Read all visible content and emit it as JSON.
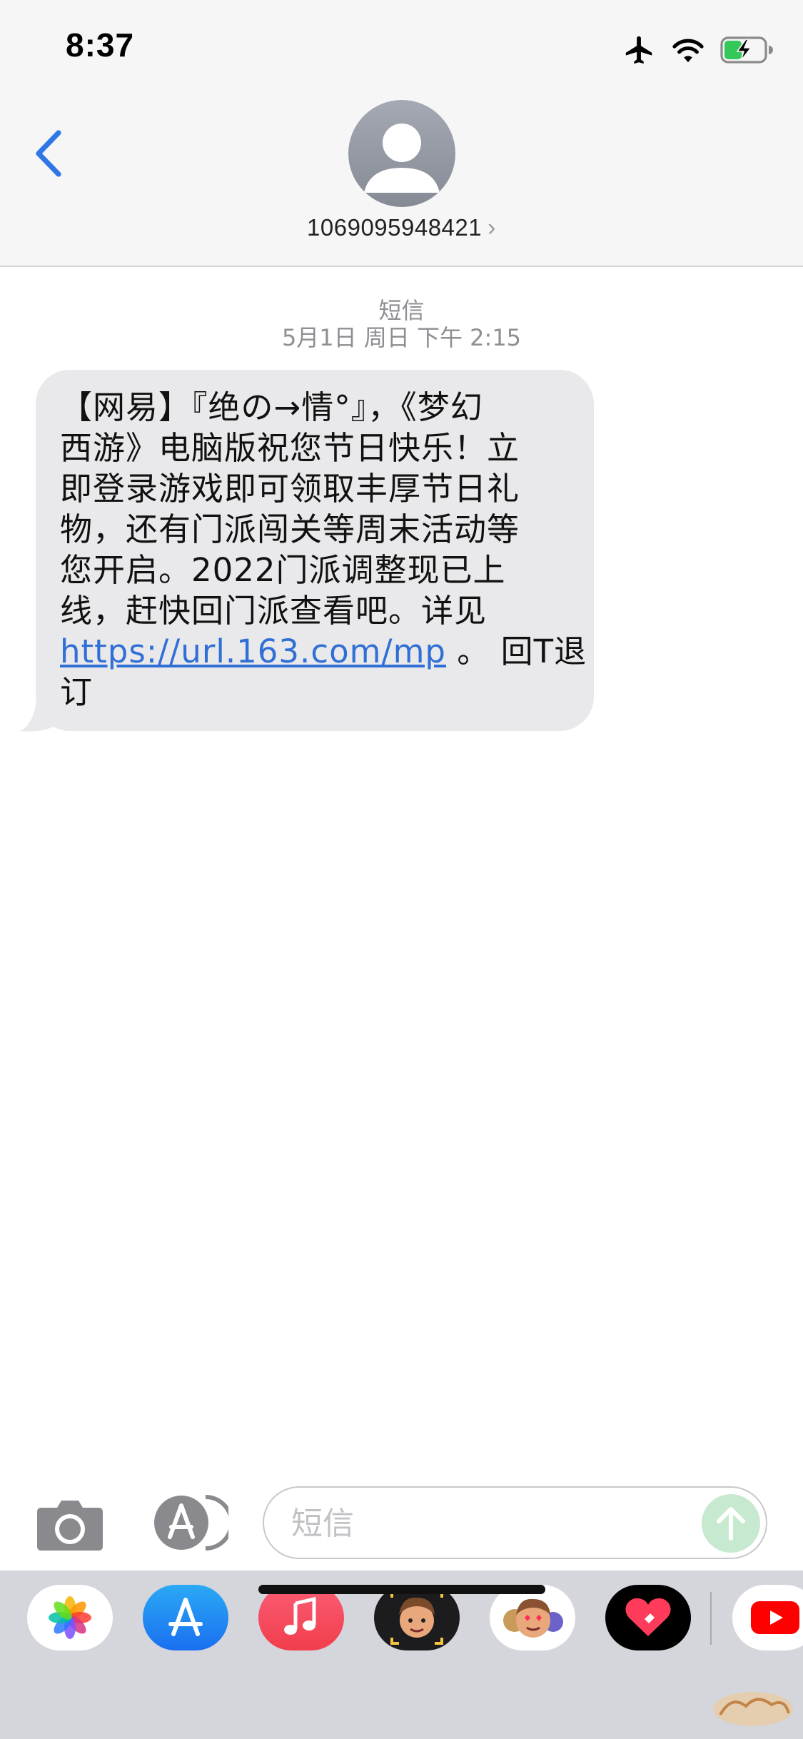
{
  "status_bar": {
    "time": "8:37"
  },
  "header": {
    "contact": "1069095948421",
    "chevron": "›"
  },
  "thread": {
    "service": "短信",
    "timestamp": "5月1日 周日 下午 2:15"
  },
  "message": {
    "lines": [
      "【网易】『绝の→情°』，《梦幻",
      "西游》电脑版祝您节日快乐！立",
      "即登录游戏即可领取丰厚节日礼",
      "物，还有门派闯关等周末活动等",
      "您开启。2022门派调整现已上",
      "线，赶快回门派查看吧。详见"
    ],
    "link": "https://url.163.com/mp",
    "after_link": " 。 回T退",
    "last_line": "订"
  },
  "composer": {
    "placeholder": "短信"
  },
  "drawer_apps": [
    "photos-app",
    "app-store-app",
    "music-app",
    "memoji-camera-app",
    "memoji-stickers-app",
    "digital-touch-app",
    "youtube-app"
  ],
  "colors": {
    "link": "#2f6fd6",
    "bubble": "#e9e9eb",
    "send": "#c7e9cf"
  }
}
